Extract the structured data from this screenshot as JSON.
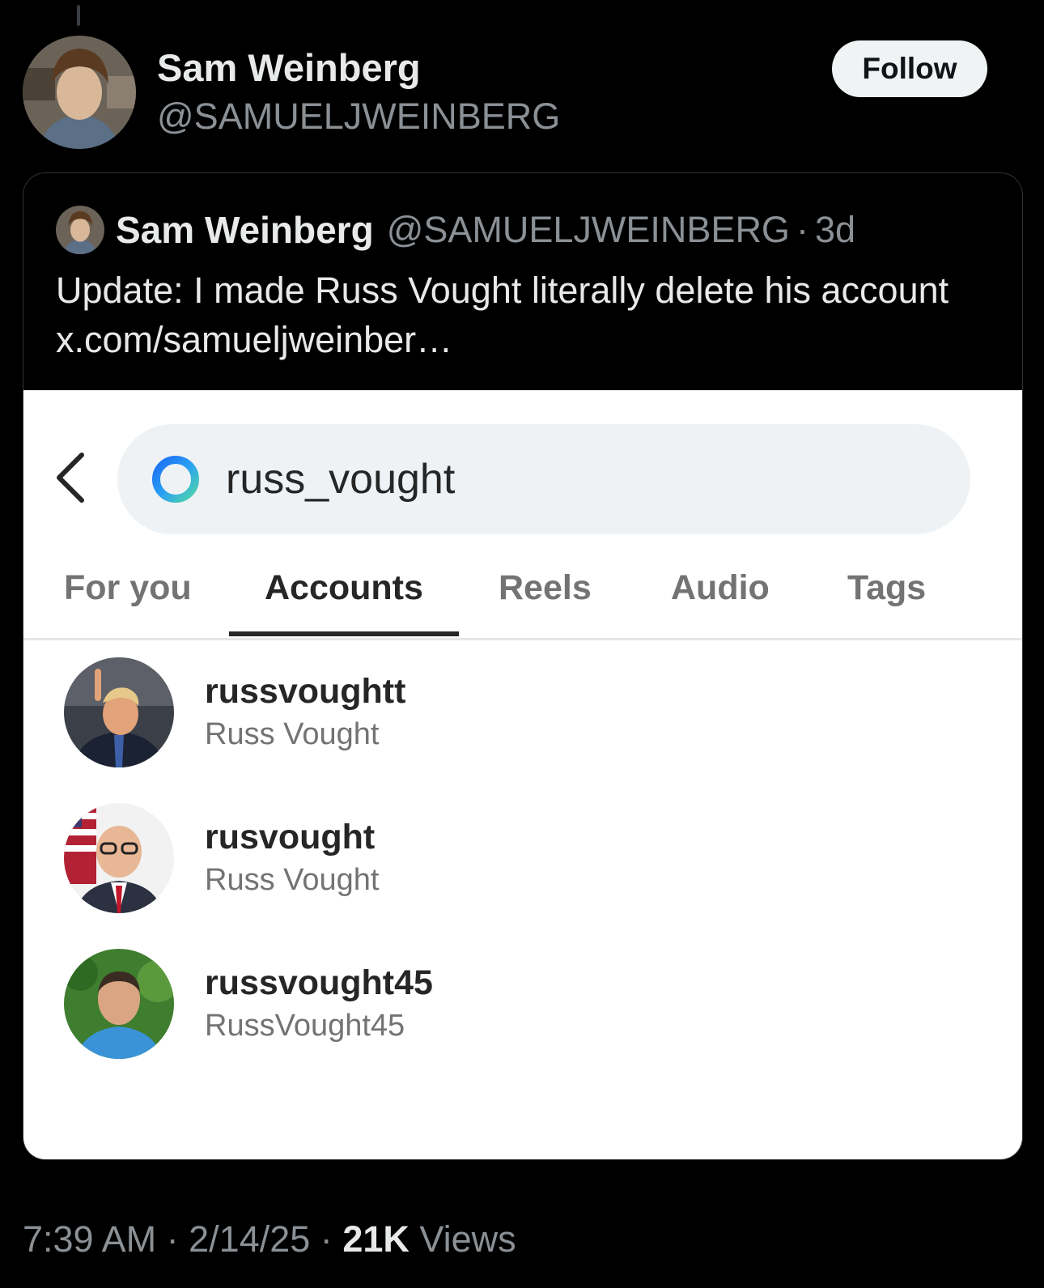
{
  "tweet": {
    "author_name": "Sam Weinberg",
    "author_handle": "@SAMUELJWEINBERG",
    "follow_label": "Follow",
    "time": "7:39 AM",
    "date": "2/14/25",
    "views_count": "21K",
    "views_label": "Views",
    "separator": "·"
  },
  "quote": {
    "author_name": "Sam Weinberg",
    "author_handle": "@SAMUELJWEINBERG",
    "separator": "·",
    "age": "3d",
    "text": "Update: I made Russ Vought literally delete his account x.com/samueljweinber…"
  },
  "screenshot": {
    "search_query": "russ_vought",
    "tabs": [
      {
        "label": "For you",
        "active": false
      },
      {
        "label": "Accounts",
        "active": true
      },
      {
        "label": "Reels",
        "active": false
      },
      {
        "label": "Audio",
        "active": false
      },
      {
        "label": "Tags",
        "active": false
      }
    ],
    "accounts": [
      {
        "username": "russvoughtt",
        "display_name": "Russ Vought",
        "avatar": "trump-pointing-photo"
      },
      {
        "username": "rusvought",
        "display_name": "Russ Vought",
        "avatar": "man-glasses-flag-photo"
      },
      {
        "username": "russvought45",
        "display_name": "RussVought45",
        "avatar": "man-blue-shirt-photo"
      }
    ]
  },
  "colors": {
    "background": "#000000",
    "text_primary": "#e7e9ea",
    "text_secondary": "#8b9095",
    "follow_bg": "#eff3f4",
    "ig_text": "#262626",
    "ig_muted": "#737373"
  }
}
